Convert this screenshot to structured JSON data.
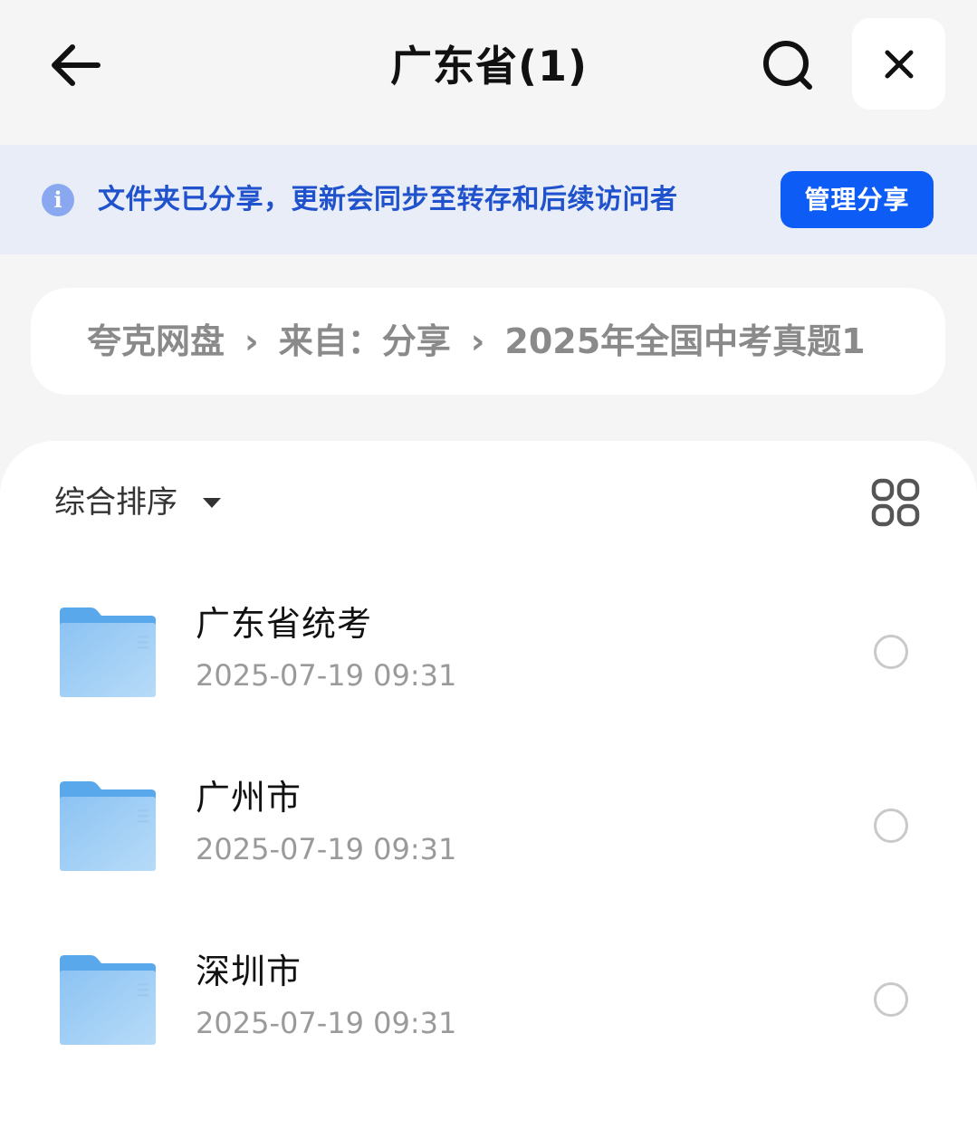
{
  "header": {
    "title": "广东省(1)",
    "back_icon": "arrow-left-icon",
    "search_icon": "search-icon",
    "close_icon": "close-icon"
  },
  "share_banner": {
    "icon": "info-icon",
    "icon_glyph": "i",
    "text": "文件夹已分享，更新会同步至转存和后续访问者",
    "button_label": "管理分享",
    "accent_color": "#0d5cf5"
  },
  "breadcrumb": {
    "items": [
      "夸克网盘",
      "来自：分享",
      "2025年全国中考真题1"
    ],
    "separator": "›"
  },
  "toolbar": {
    "sort_label": "综合排序",
    "sort_icon": "caret-down-icon",
    "view_icon": "grid-view-icon"
  },
  "files": [
    {
      "name": "广东省统考",
      "date": "2025-07-19 09:31",
      "icon": "folder-icon"
    },
    {
      "name": "广州市",
      "date": "2025-07-19 09:31",
      "icon": "folder-icon"
    },
    {
      "name": "深圳市",
      "date": "2025-07-19 09:31",
      "icon": "folder-icon"
    }
  ]
}
